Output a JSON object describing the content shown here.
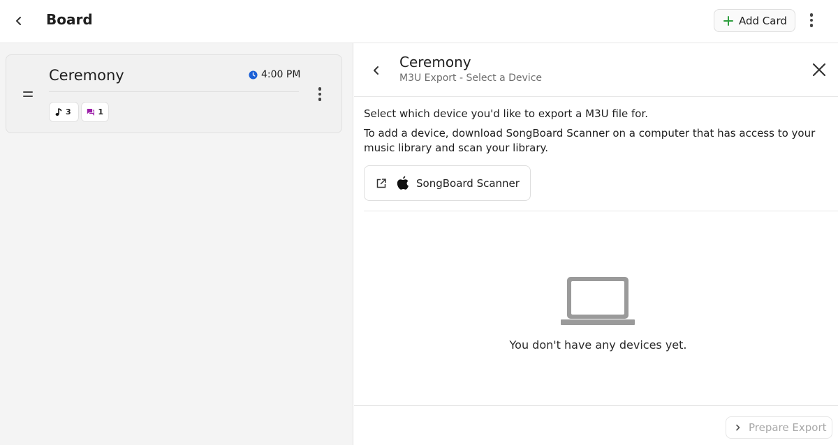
{
  "header": {
    "title": "Board",
    "add_card_label": "Add Card"
  },
  "card": {
    "title": "Ceremony",
    "time": "4:00 PM",
    "song_count": "3",
    "comment_count": "1"
  },
  "panel": {
    "title": "Ceremony",
    "subtitle": "M3U Export - Select a Device",
    "instruction_1": "Select which device you'd like to export a M3U file for.",
    "instruction_2": "To add a device, download SongBoard Scanner on a computer that has access to your music library and scan your library.",
    "scanner_button_label": "SongBoard Scanner",
    "empty_message": "You don't have any devices yet.",
    "prepare_export_label": "Prepare Export"
  },
  "colors": {
    "add_accent": "#2e9e3e",
    "clock": "#1a5fd6",
    "comment_icon": "#9b1fa8",
    "empty_icon": "#9a9a9a",
    "disabled_text": "#a8a8a8"
  }
}
